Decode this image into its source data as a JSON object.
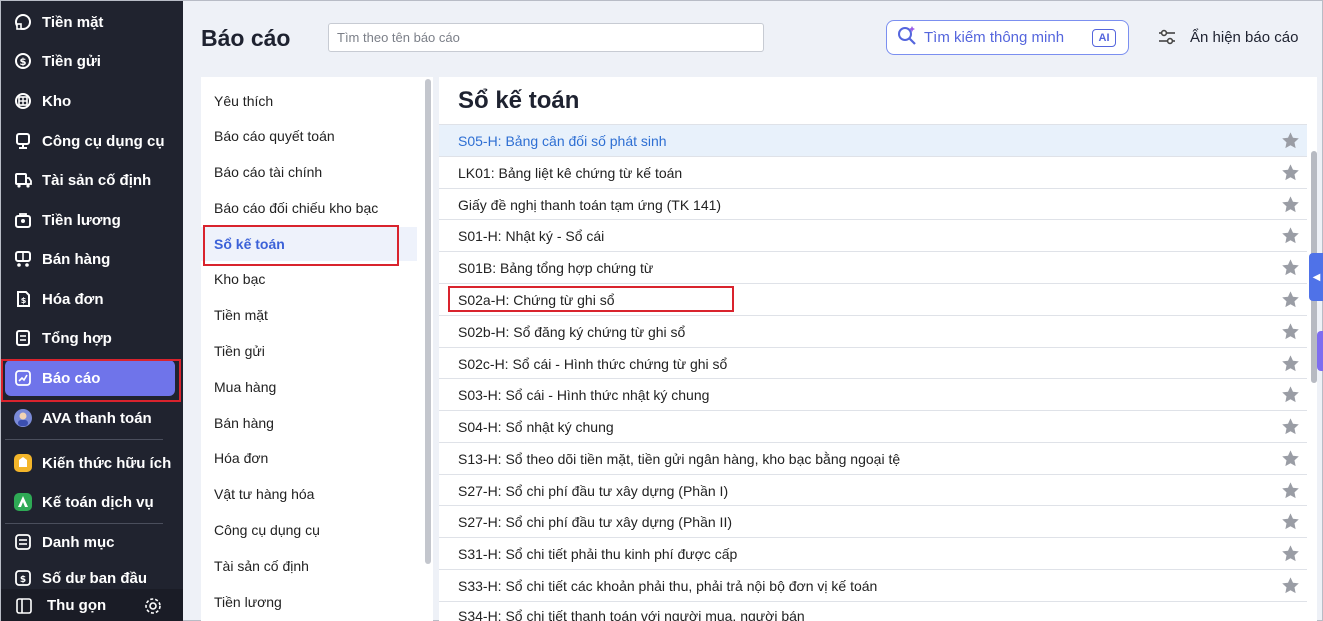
{
  "sidebar": {
    "items": [
      {
        "label": "Tiền mặt",
        "icon": "cash-icon"
      },
      {
        "label": "Tiền gửi",
        "icon": "deposit-icon"
      },
      {
        "label": "Kho",
        "icon": "warehouse-icon"
      },
      {
        "label": "Công cụ dụng cụ",
        "icon": "tools-icon"
      },
      {
        "label": "Tài sản cố định",
        "icon": "truck-icon"
      },
      {
        "label": "Tiền lương",
        "icon": "salary-icon"
      },
      {
        "label": "Bán hàng",
        "icon": "cart-icon"
      },
      {
        "label": "Hóa đơn",
        "icon": "invoice-icon"
      },
      {
        "label": "Tổng hợp",
        "icon": "summary-icon"
      },
      {
        "label": "Báo cáo",
        "icon": "report-chart-icon"
      },
      {
        "label": "AVA thanh toán",
        "icon": "ava-avatar-icon"
      },
      {
        "label": "Kiến thức hữu ích",
        "icon": "knowledge-icon"
      },
      {
        "label": "Kế toán dịch vụ",
        "icon": "service-icon"
      },
      {
        "label": "Danh mục",
        "icon": "list-icon"
      },
      {
        "label": "Số dư ban đầu",
        "icon": "balance-icon"
      }
    ],
    "active_label": "Báo cáo",
    "collapse_label": "Thu gọn"
  },
  "header": {
    "title": "Báo cáo",
    "search_placeholder": "Tìm theo tên báo cáo",
    "smart_search_label": "Tìm kiếm thông minh",
    "ai_badge": "AI",
    "toggle_reports_label": "Ẩn hiện báo cáo"
  },
  "categories": {
    "items": [
      "Yêu thích",
      "Báo cáo quyết toán",
      "Báo cáo tài chính",
      "Báo cáo đối chiếu kho bạc",
      "Sổ kế toán",
      "Kho bạc",
      "Tiền mặt",
      "Tiền gửi",
      "Mua hàng",
      "Bán hàng",
      "Hóa đơn",
      "Vật tư hàng hóa",
      "Công cụ dụng cụ",
      "Tài sản cố định",
      "Tiền lương"
    ],
    "selected": "Sổ kế toán"
  },
  "reports": {
    "title": "Sổ kế toán",
    "rows": [
      "S05-H: Bảng cân đối số phát sinh",
      "LK01: Bảng liệt kê chứng từ kế toán",
      "Giấy đề nghị thanh toán tạm ứng (TK 141)",
      "S01-H: Nhật ký - Sổ cái",
      "S01B: Bảng tổng hợp chứng từ",
      "S02a-H: Chứng từ ghi sổ",
      "S02b-H: Sổ đăng ký chứng từ ghi sổ",
      "S02c-H: Sổ cái - Hình thức chứng từ ghi sổ",
      "S03-H: Sổ cái - Hình thức nhật ký chung",
      "S04-H: Sổ nhật ký chung",
      "S13-H: Sổ theo dõi tiền mặt, tiền gửi ngân hàng, kho bạc bằng ngoại tệ",
      "S27-H: Sổ chi phí đầu tư xây dựng (Phần I)",
      "S27-H: Sổ chi phí đầu tư xây dựng (Phần II)",
      "S31-H: Sổ chi tiết phải thu kinh phí được cấp",
      "S33-H: Sổ chi tiết các khoản phải thu, phải trả nội bộ đơn vị kế toán",
      "S34-H: Sổ chi tiết thanh toán với người mua, người bán"
    ],
    "highlighted_row": "S05-H: Bảng cân đối số phát sinh"
  },
  "colors": {
    "sidebar_bg": "#20232f",
    "active_bg": "#6f74ea",
    "accent_blue": "#3c62d8",
    "annotation_red": "#d9232d"
  }
}
